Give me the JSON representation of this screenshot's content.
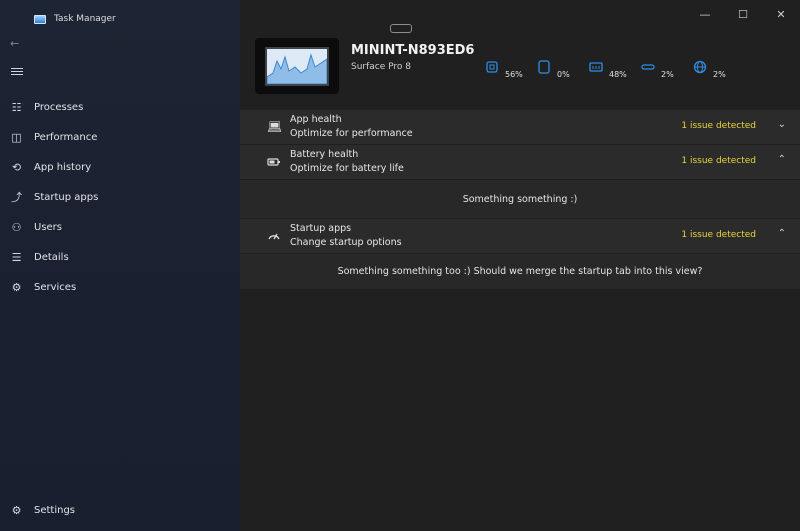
{
  "app": {
    "title": "Task Manager"
  },
  "sidebar": {
    "items": [
      {
        "label": "Processes",
        "icon": "processes-icon",
        "glyph": "☷"
      },
      {
        "label": "Performance",
        "icon": "performance-icon",
        "glyph": "◫"
      },
      {
        "label": "App history",
        "icon": "history-icon",
        "glyph": "⟲"
      },
      {
        "label": "Startup apps",
        "icon": "startup-icon",
        "glyph": "⤴"
      },
      {
        "label": "Users",
        "icon": "users-icon",
        "glyph": "⚇"
      },
      {
        "label": "Details",
        "icon": "details-icon",
        "glyph": "☰"
      },
      {
        "label": "Services",
        "icon": "services-icon",
        "glyph": "⚙"
      }
    ],
    "settings_label": "Settings"
  },
  "window_controls": {
    "minimize": "—",
    "maximize": "☐",
    "close": "✕"
  },
  "device": {
    "name": "MININT-N893ED6",
    "model": "Surface Pro 8"
  },
  "metrics": [
    {
      "icon": "cpu-icon",
      "value": "56%"
    },
    {
      "icon": "memory-icon",
      "value": "0%"
    },
    {
      "icon": "disk-icon",
      "value": "48%"
    },
    {
      "icon": "gpu-icon",
      "value": "2%"
    },
    {
      "icon": "network-icon",
      "value": "2%"
    }
  ],
  "cards": [
    {
      "title": "App health",
      "subtitle": "Optimize for performance",
      "status": "1 issue detected",
      "chevron": "⌄",
      "icon": "laptop-icon",
      "body": ""
    },
    {
      "title": "Battery health",
      "subtitle": "Optimize for battery life",
      "status": "1 issue detected",
      "chevron": "⌃",
      "icon": "battery-icon",
      "body": "Something something :)"
    },
    {
      "title": "Startup apps",
      "subtitle": "Change startup options",
      "status": "1 issue detected",
      "chevron": "⌃",
      "icon": "speedometer-icon",
      "body": "Something something too :) Should we merge the startup tab into this view?"
    }
  ],
  "colors": {
    "accent": "#2f8ce6",
    "warning": "#e8d43a",
    "sidebar": "#1b2232",
    "panel": "#2b2b2b"
  }
}
